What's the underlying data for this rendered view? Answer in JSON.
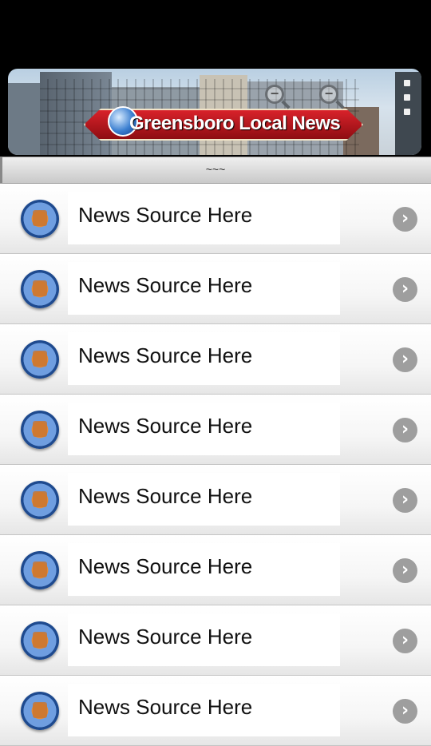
{
  "banner": {
    "title": "Greensboro Local News"
  },
  "divider": {
    "text": "~~~"
  },
  "icons": {
    "zoom_out": "zoom-out-icon",
    "zoom_in": "zoom-in-icon",
    "menu": "menu-icon",
    "row": "news-globe-icon",
    "chevron": "chevron-right-icon"
  },
  "list": {
    "items": [
      {
        "label": "News Source Here"
      },
      {
        "label": "News Source Here"
      },
      {
        "label": "News Source Here"
      },
      {
        "label": "News Source Here"
      },
      {
        "label": "News Source Here"
      },
      {
        "label": "News Source Here"
      },
      {
        "label": "News Source Here"
      },
      {
        "label": "News Source Here"
      }
    ]
  }
}
